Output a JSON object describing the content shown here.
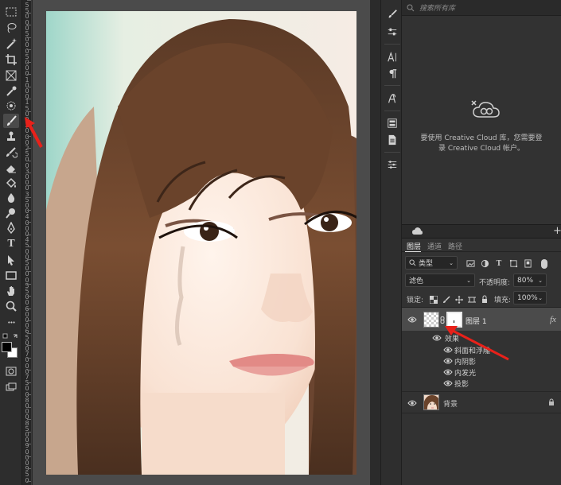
{
  "left_toolbar": {
    "tools": [
      {
        "name": "marquee-tool",
        "icon": "marquee-icon"
      },
      {
        "name": "lasso-tool",
        "icon": "lasso-icon"
      },
      {
        "name": "magic-wand-tool",
        "icon": "magic-wand-icon"
      },
      {
        "name": "crop-tool",
        "icon": "crop-icon"
      },
      {
        "name": "frame-tool",
        "icon": "frame-icon"
      },
      {
        "name": "eyedropper-tool",
        "icon": "eyedropper-icon"
      },
      {
        "name": "spot-healing-tool",
        "icon": "healing-icon"
      },
      {
        "name": "brush-tool",
        "icon": "brush-icon",
        "active": true
      },
      {
        "name": "clone-stamp-tool",
        "icon": "stamp-icon"
      },
      {
        "name": "history-brush-tool",
        "icon": "history-brush-icon"
      },
      {
        "name": "eraser-tool",
        "icon": "eraser-icon"
      },
      {
        "name": "paint-bucket-tool",
        "icon": "bucket-icon"
      },
      {
        "name": "blur-tool",
        "icon": "drop-icon"
      },
      {
        "name": "dodge-tool",
        "icon": "dodge-icon"
      },
      {
        "name": "pen-tool",
        "icon": "pen-icon"
      },
      {
        "name": "type-tool",
        "icon": "type-icon",
        "glyph": "T"
      },
      {
        "name": "path-selection-tool",
        "icon": "arrow-icon"
      },
      {
        "name": "rectangle-tool",
        "icon": "rectangle-icon"
      },
      {
        "name": "hand-tool",
        "icon": "hand-icon"
      },
      {
        "name": "zoom-tool",
        "icon": "zoom-icon"
      },
      {
        "name": "more-tools",
        "icon": "ellipsis-icon",
        "glyph": "•••"
      }
    ],
    "foreground_color": "#000000",
    "background_color": "#ffffff"
  },
  "ruler": {
    "numbers": [
      "5",
      "5",
      "0",
      "0",
      "0",
      "5",
      "0",
      "0",
      "0",
      "5",
      "0",
      "0",
      "0",
      "1",
      "0",
      "0",
      "0",
      "1",
      "5",
      "0",
      "0",
      "2",
      "0",
      "0",
      "0",
      "2",
      "5",
      "0",
      "0",
      "3",
      "0",
      "0",
      "0",
      "3",
      "5",
      "0",
      "0",
      "4",
      "0",
      "0",
      "0",
      "4",
      "5",
      "0",
      "0",
      "5",
      "0",
      "0",
      "0",
      "5",
      "5",
      "0",
      "0",
      "6",
      "0",
      "0",
      "0",
      "6",
      "5",
      "0",
      "0",
      "7",
      "0",
      "0",
      "0",
      "7",
      "5",
      "0",
      "0",
      "8",
      "0",
      "0",
      "0",
      "8",
      "5",
      "0",
      "0",
      "9",
      "0",
      "0",
      "0",
      "9",
      "5",
      "0"
    ]
  },
  "libraries": {
    "search_placeholder": "搜索所有库",
    "message_line1": "要使用 Creative Cloud 库，您需要登",
    "message_line2": "录 Creative Cloud 帐户。"
  },
  "layers_panel": {
    "tabs": [
      "图层",
      "通道",
      "路径"
    ],
    "filter_kind": "类型",
    "blend_mode": "滤色",
    "opacity_label": "不透明度:",
    "opacity_value": "80%",
    "lock_label": "锁定:",
    "fill_label": "填充:",
    "fill_value": "100%",
    "layer1_name": "图层 1",
    "fx_label": "fx",
    "effects_label": "效果",
    "effects": [
      "斜面和浮雕",
      "内阴影",
      "内发光",
      "投影"
    ],
    "background_layer_name": "背景"
  },
  "colors": {
    "annotation_arrow": "#e8211a",
    "selected_layer": "#4b4b4b",
    "canvas_bg": "#4b4b4b"
  }
}
